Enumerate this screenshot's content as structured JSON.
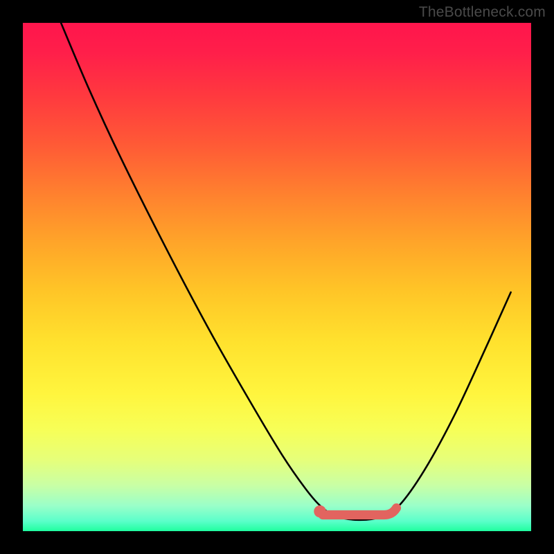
{
  "attribution": "TheBottleneck.com",
  "chart_data": {
    "type": "line",
    "title": "",
    "xlabel": "",
    "ylabel": "",
    "xlim": [
      0,
      1
    ],
    "ylim": [
      0,
      1
    ],
    "curve": {
      "name": "bottleneck-curve",
      "color": "#000000",
      "points": [
        {
          "x": 0.075,
          "y": 1.0
        },
        {
          "x": 0.13,
          "y": 0.87
        },
        {
          "x": 0.19,
          "y": 0.74
        },
        {
          "x": 0.28,
          "y": 0.56
        },
        {
          "x": 0.37,
          "y": 0.39
        },
        {
          "x": 0.45,
          "y": 0.25
        },
        {
          "x": 0.51,
          "y": 0.15
        },
        {
          "x": 0.555,
          "y": 0.085
        },
        {
          "x": 0.585,
          "y": 0.05
        },
        {
          "x": 0.615,
          "y": 0.03
        },
        {
          "x": 0.66,
          "y": 0.022
        },
        {
          "x": 0.705,
          "y": 0.028
        },
        {
          "x": 0.74,
          "y": 0.05
        },
        {
          "x": 0.79,
          "y": 0.12
        },
        {
          "x": 0.85,
          "y": 0.23
        },
        {
          "x": 0.915,
          "y": 0.37
        },
        {
          "x": 0.96,
          "y": 0.47
        }
      ]
    },
    "highlight_band": {
      "color": "#e2645f",
      "y": 0.032,
      "x_start": 0.59,
      "x_end": 0.735,
      "thickness": 0.018,
      "left_dot_radius": 0.012
    },
    "gradient_stops": [
      {
        "pos": 0.0,
        "color": "#ff154c"
      },
      {
        "pos": 0.5,
        "color": "#ffe030"
      },
      {
        "pos": 1.0,
        "color": "#1fff9f"
      }
    ]
  }
}
